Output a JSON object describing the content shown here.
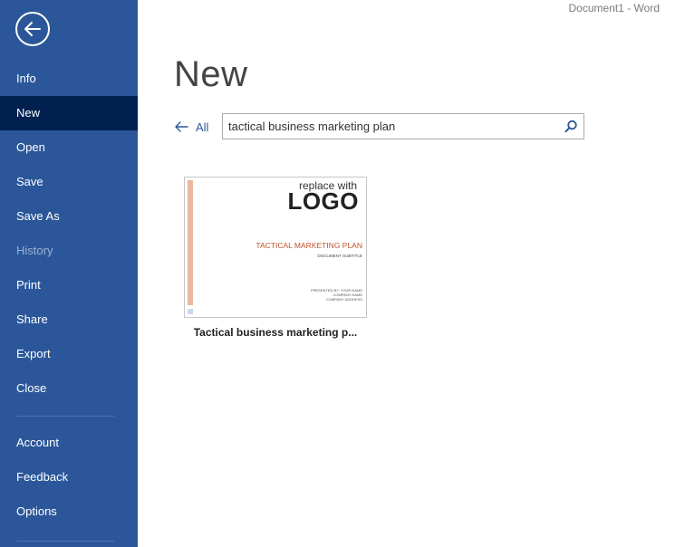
{
  "window": {
    "title": "Document1  -  Word"
  },
  "sidebar": {
    "back_icon": "arrow-left-circle-icon",
    "items": [
      {
        "label": "Info"
      },
      {
        "label": "New",
        "active": true
      },
      {
        "label": "Open"
      },
      {
        "label": "Save"
      },
      {
        "label": "Save As"
      },
      {
        "label": "History",
        "disabled": true
      },
      {
        "label": "Print"
      },
      {
        "label": "Share"
      },
      {
        "label": "Export"
      },
      {
        "label": "Close"
      },
      {
        "label": "Account"
      },
      {
        "label": "Feedback"
      },
      {
        "label": "Options"
      }
    ]
  },
  "main": {
    "title": "New",
    "back_label": "All",
    "search": {
      "value": "tactical business marketing plan",
      "icon": "search-icon"
    },
    "templates": [
      {
        "name": "Tactical business marketing p...",
        "thumbnail": {
          "replace_with": "replace with",
          "logo": "LOGO",
          "doc_title": "TACTICAL MARKETING PLAN",
          "doc_subtitle": "DOCUMENT SUBTITLE",
          "presented_by": "PRESENTED BY: YOUR NAME",
          "company_name": "COMPANY NAME",
          "company_address": "COMPANY ADDRESS"
        }
      }
    ]
  },
  "colors": {
    "sidebar_bg": "#2b579a",
    "sidebar_active_bg": "#002050",
    "accent": "#2b579a",
    "template_title": "#c0522a",
    "template_bar": "#e9b8a0"
  }
}
